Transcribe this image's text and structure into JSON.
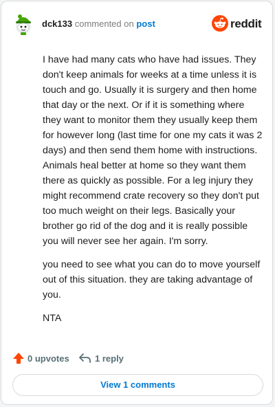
{
  "header": {
    "username": "dck133",
    "action_text": "commented on",
    "target_link": "post",
    "brand": "reddit"
  },
  "comment": {
    "paragraphs": [
      "I have had many cats who have had issues. They don't keep animals for weeks at a time unless it is touch and go. Usually it is surgery and then home that day or the next. Or if it is something where they want to monitor them they usually keep them for however long (last time for one my cats it was 2 days) and then send them home with instructions. Animals heal better at home so they want them there as quickly as possible. For a leg injury they might recommend crate recovery so they don't put too much weight on their legs. Basically your brother go rid of the dog and it is really possible you will never see her again. I'm sorry.",
      "you need to see what you can do to move yourself out of this situation. they are taking advantage of you.",
      "NTA"
    ]
  },
  "actions": {
    "upvotes": "0 upvotes",
    "reply": "1 reply"
  },
  "footer": {
    "view_comments": "View 1 comments"
  },
  "colors": {
    "reddit_orange": "#ff4500",
    "link_blue": "#0079d3",
    "muted_text": "#576f76",
    "upvote_arrow": "#ff4500"
  },
  "icons": {
    "avatar": "snoo-avatar-icon",
    "brand": "reddit-logo-icon",
    "upvote": "upvote-arrow-icon",
    "reply": "reply-arrow-icon"
  }
}
